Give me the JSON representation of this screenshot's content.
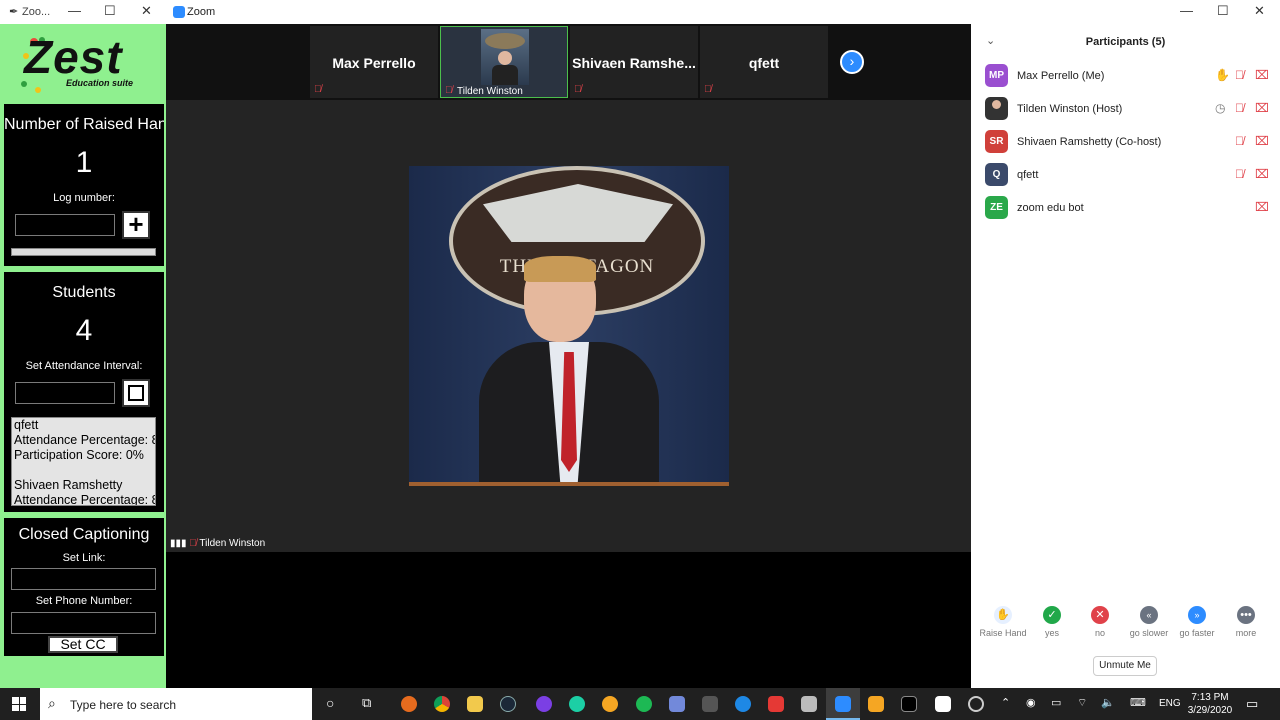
{
  "zest": {
    "window_title": "Zoo...",
    "logo": "Zest",
    "logo_sub": "Education suite",
    "raised": {
      "title": "Number of Raised Hands",
      "count": "1",
      "log_label": "Log number:",
      "add_symbol": "+"
    },
    "students": {
      "title": "Students",
      "count": "4",
      "interval_label": "Set Attendance Interval:",
      "list": [
        "qfett",
        "Attendance Percentage: 8",
        "Participation Score: 0%",
        "",
        "Shivaen Ramshetty",
        "Attendance Percentage: 8"
      ]
    },
    "cc": {
      "title": "Closed Captioning",
      "link_label": "Set Link:",
      "phone_label": "Set Phone Number:",
      "button": "Set CC"
    }
  },
  "zoom": {
    "window_title": "Zoom",
    "tiles": [
      {
        "name": "Max Perrello"
      },
      {
        "name": "Tilden Winston",
        "has_video": true
      },
      {
        "name": "Shivaen Ramshe..."
      },
      {
        "name": "qfett"
      }
    ],
    "speaker_name": "Tilden Winston",
    "podium_text": "THE PENTAGON"
  },
  "participants": {
    "title": "Participants (5)",
    "list": [
      {
        "initials": "MP",
        "name": "Max Perrello (Me)",
        "color": "#9a4fd0",
        "hand": true
      },
      {
        "initials": "",
        "name": "Tilden Winston (Host)",
        "color": "#333333",
        "clock": true
      },
      {
        "initials": "SR",
        "name": "Shivaen Ramshetty (Co-host)",
        "color": "#d0403a"
      },
      {
        "initials": "Q",
        "name": "qfett",
        "color": "#3b4a6b"
      },
      {
        "initials": "ZE",
        "name": "zoom edu bot",
        "color": "#2aa84a"
      }
    ],
    "reactions": [
      {
        "label": "Raise Hand",
        "icon": "raise-hand-icon",
        "color": "#2d8cff"
      },
      {
        "label": "yes",
        "icon": "check-icon",
        "color": "#21a84a"
      },
      {
        "label": "no",
        "icon": "x-icon",
        "color": "#e0424a"
      },
      {
        "label": "go slower",
        "icon": "rewind-icon",
        "color": "#6b7381"
      },
      {
        "label": "go faster",
        "icon": "fast-forward-icon",
        "color": "#2d8cff"
      },
      {
        "label": "more",
        "icon": "more-icon",
        "color": "#6b7381"
      }
    ],
    "unmute": "Unmute Me"
  },
  "taskbar": {
    "search_placeholder": "Type here to search",
    "lang": "ENG",
    "time": "7:13 PM",
    "date": "3/29/2020"
  }
}
